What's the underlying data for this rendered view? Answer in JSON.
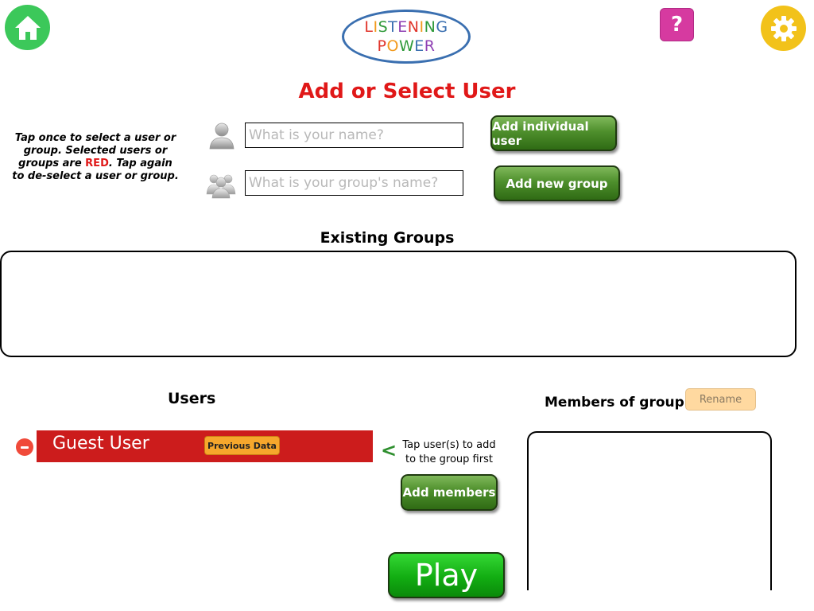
{
  "logo": {
    "line1": [
      {
        "ch": "L",
        "color": "#e0352b"
      },
      {
        "ch": "I",
        "color": "#f29a1d"
      },
      {
        "ch": "S",
        "color": "#2f9a3a"
      },
      {
        "ch": "T",
        "color": "#3a6fb0"
      },
      {
        "ch": "E",
        "color": "#8e3fb3"
      },
      {
        "ch": "N",
        "color": "#e0352b"
      },
      {
        "ch": "I",
        "color": "#f29a1d"
      },
      {
        "ch": "N",
        "color": "#2f9a3a"
      },
      {
        "ch": "G",
        "color": "#3a6fb0"
      }
    ],
    "line2": [
      {
        "ch": "P",
        "color": "#e0352b"
      },
      {
        "ch": "O",
        "color": "#f29a1d"
      },
      {
        "ch": "W",
        "color": "#2f9a3a"
      },
      {
        "ch": "E",
        "color": "#3a6fb0"
      },
      {
        "ch": "R",
        "color": "#8e3fb3"
      }
    ]
  },
  "header": {
    "home_icon": "home-icon",
    "help_label": "?",
    "settings_icon": "gear-icon"
  },
  "page_title": "Add or Select User",
  "instructions": {
    "part1": "Tap once to select a user or group. Selected users or groups are ",
    "highlight": "RED",
    "part2": ". Tap again to de-select a user or group."
  },
  "form": {
    "name_placeholder": "What is your name?",
    "name_value": "",
    "group_placeholder": "What is your group's name?",
    "group_value": "",
    "add_user_label": "Add individual user",
    "add_group_label": "Add new group"
  },
  "existing_groups": {
    "label": "Existing Groups",
    "items": []
  },
  "users": {
    "label": "Users",
    "items": [
      {
        "name": "Guest User",
        "previous_data_label": "Previous Data"
      }
    ]
  },
  "members": {
    "label": "Members of group",
    "rename_label": "Rename",
    "arrow": "<",
    "hint": "Tap user(s) to add to the group first",
    "add_members_label": "Add members",
    "items": []
  },
  "play_label": "Play",
  "colors": {
    "accent_red": "#e01818",
    "selected_row": "#cc1c1c",
    "button_green": "#4e8f2c",
    "play_green": "#12ad12",
    "home_green": "#3cc85a",
    "help_pink": "#d63aa0",
    "settings_yellow": "#f2c21a"
  }
}
